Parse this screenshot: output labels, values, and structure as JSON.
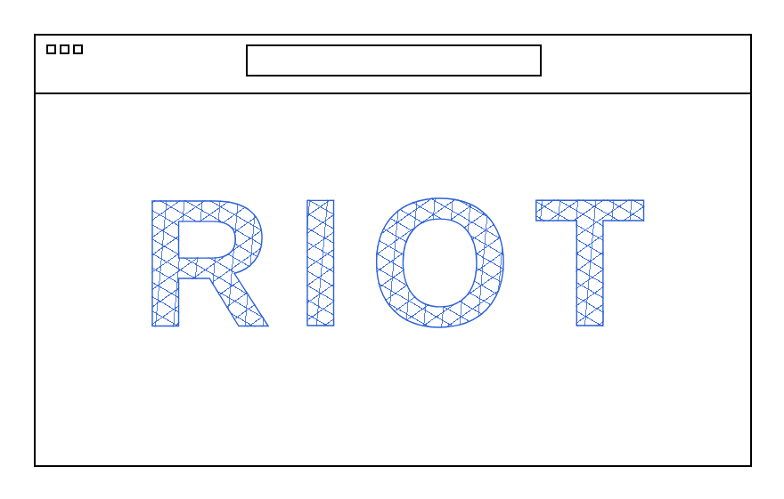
{
  "address_bar": {
    "value": ""
  },
  "content": {
    "title": "RIOT"
  }
}
